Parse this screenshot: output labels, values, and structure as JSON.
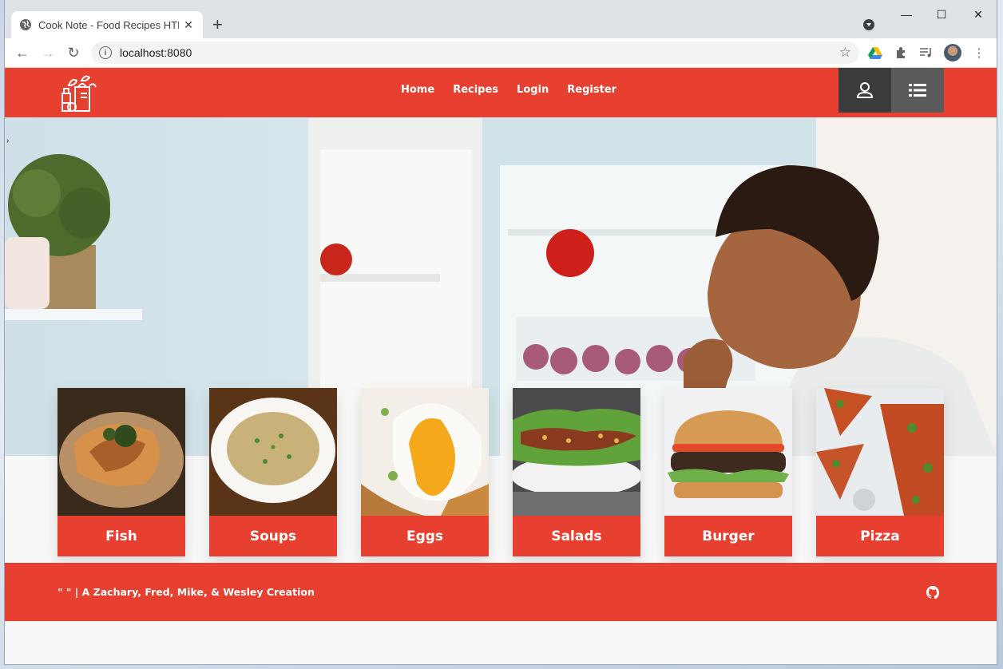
{
  "browser": {
    "tab_title": "Cook Note - Food Recipes HTML",
    "url": "localhost:8080",
    "new_tab_symbol": "+",
    "close_symbol": "✕"
  },
  "site": {
    "brand_color": "#e84030",
    "nav": [
      {
        "label": "Home"
      },
      {
        "label": "Recipes"
      },
      {
        "label": "Login"
      },
      {
        "label": "Register"
      }
    ],
    "categories": [
      {
        "label": "Fish",
        "icon": "fish-thumbnail"
      },
      {
        "label": "Soups",
        "icon": "soup-thumbnail"
      },
      {
        "label": "Eggs",
        "icon": "egg-thumbnail"
      },
      {
        "label": "Salads",
        "icon": "salad-thumbnail"
      },
      {
        "label": "Burger",
        "icon": "burger-thumbnail"
      },
      {
        "label": "Pizza",
        "icon": "pizza-thumbnail"
      }
    ],
    "footer_text": "\" \" | A Zachary, Fred, Mike, & Wesley Creation"
  }
}
